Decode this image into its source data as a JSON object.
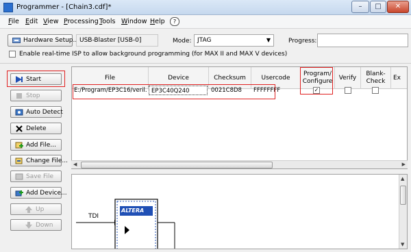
{
  "window": {
    "title": "Programmer - [Chain3.cdf]*",
    "controls": [
      "–",
      "□",
      "✕"
    ]
  },
  "menubar": {
    "items": [
      "File",
      "Edit",
      "View",
      "Processing",
      "Tools",
      "Window",
      "Help"
    ],
    "help_icon": "?"
  },
  "toolbar": {
    "hardware_setup_label": "Hardware Setup...",
    "hardware_value": "USB-Blaster [USB-0]",
    "mode_label": "Mode:",
    "mode_value": "JTAG",
    "progress_label": "Progress:",
    "progress_value": "",
    "isp_checkbox_label": "Enable real-time ISP to allow background programming (for MAX II and MAX V devices)",
    "isp_checked": false
  },
  "side_buttons": [
    {
      "label": "Start",
      "icon": "start-icon",
      "enabled": true
    },
    {
      "label": "Stop",
      "icon": "stop-icon",
      "enabled": false
    },
    {
      "label": "Auto Detect",
      "icon": "auto-detect-icon",
      "enabled": true
    },
    {
      "label": "Delete",
      "icon": "delete-icon",
      "enabled": true
    },
    {
      "label": "Add File...",
      "icon": "add-file-icon",
      "enabled": true
    },
    {
      "label": "Change File...",
      "icon": "change-file-icon",
      "enabled": true
    },
    {
      "label": "Save File",
      "icon": "save-file-icon",
      "enabled": false
    },
    {
      "label": "Add Device...",
      "icon": "add-device-icon",
      "enabled": true
    },
    {
      "label": "Up",
      "icon": "up-icon",
      "enabled": false
    },
    {
      "label": "Down",
      "icon": "down-icon",
      "enabled": false
    }
  ],
  "grid": {
    "columns": [
      "File",
      "Device",
      "Checksum",
      "Usercode",
      "Program/\nConfigure",
      "Verify",
      "Blank-\nCheck",
      "Ex"
    ],
    "rows": [
      {
        "file": "E:/Program/EP3C16/veril...",
        "device": "EP3C40Q240",
        "checksum": "0021C8D8",
        "usercode": "FFFFFFFF",
        "program_configure": true,
        "verify": false,
        "blank_check": false
      }
    ]
  },
  "chain": {
    "tdi_label": "TDI",
    "chip_logo": "ALTERA"
  },
  "colors": {
    "highlight_red": "#e02020",
    "title_bar": "#c5d8ee"
  }
}
